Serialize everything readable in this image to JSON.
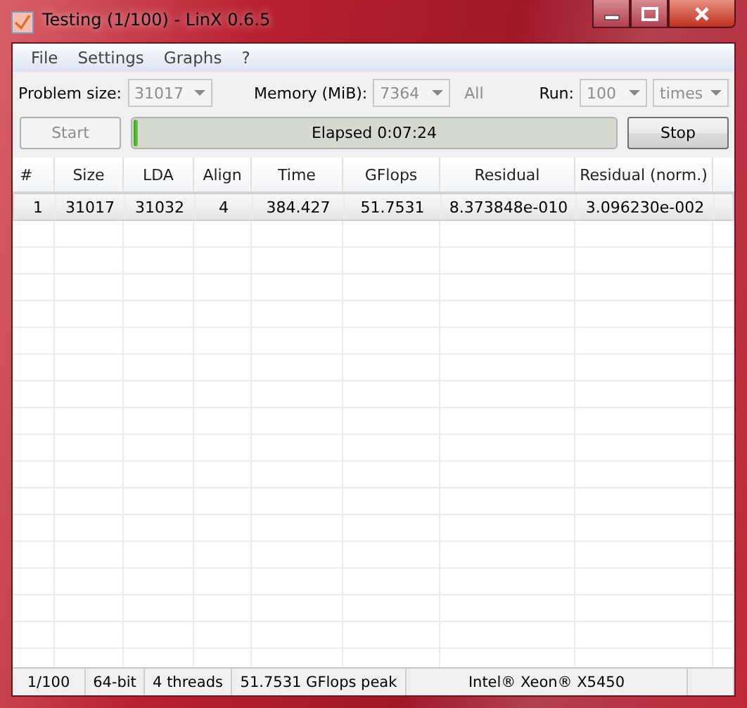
{
  "window": {
    "title": "Testing (1/100) - LinX 0.6.5"
  },
  "menu": [
    "File",
    "Settings",
    "Graphs",
    "?"
  ],
  "controls": {
    "problem_size": {
      "label": "Problem size:",
      "value": "31017",
      "disabled": true
    },
    "memory": {
      "label": "Memory (MiB):",
      "value": "7364",
      "disabled": true
    },
    "all": {
      "label": "All",
      "disabled": true
    },
    "run": {
      "label": "Run:",
      "value": "100",
      "disabled": true
    },
    "run_unit": {
      "value": "times",
      "disabled": true
    }
  },
  "start_button": {
    "label": "Start",
    "disabled": true
  },
  "progress": {
    "text": "Elapsed 0:07:24",
    "level": 0.01
  },
  "stop_button": {
    "label": "Stop",
    "disabled": false
  },
  "table": {
    "columns": [
      "#",
      "Size",
      "LDA",
      "Align",
      "Time",
      "GFlops",
      "Residual",
      "Residual (norm.)"
    ],
    "rows": [
      [
        "1",
        "31017",
        "31032",
        "4",
        "384.427",
        "51.7531",
        "8.373848e-010",
        "3.096230e-002"
      ]
    ]
  },
  "status_bar": [
    "1/100",
    "64-bit",
    "4 threads",
    "51.7531 GFlops peak",
    "Intel® Xeon® X5450"
  ]
}
